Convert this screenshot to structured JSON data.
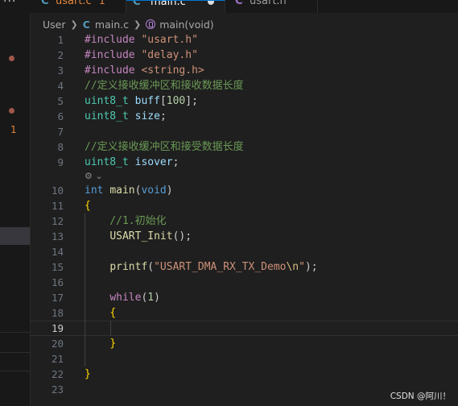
{
  "tabs": [
    {
      "icon": "C",
      "name": "usart.c",
      "badge": "1",
      "active": false,
      "modified": false
    },
    {
      "icon": "C",
      "name": "main.c",
      "active": true,
      "modified": true
    },
    {
      "icon": "C",
      "name": "usart.h",
      "active": false,
      "modified": false
    }
  ],
  "breadcrumb": {
    "root": "User",
    "file_icon": "C",
    "file": "main.c",
    "symbol": "main(void)"
  },
  "sidebar": {
    "badge": "1"
  },
  "editor": {
    "current_line": 19,
    "inlay_hint": "⚙ ⌄",
    "lines": [
      {
        "n": "1",
        "code": "#include \"usart.h\""
      },
      {
        "n": "2",
        "code": "#include \"delay.h\""
      },
      {
        "n": "3",
        "code": "#include <string.h>"
      },
      {
        "n": "4",
        "code": "//定义接收缓冲区和接收数据长度"
      },
      {
        "n": "5",
        "code": "uint8_t buff[100];"
      },
      {
        "n": "6",
        "code": "uint8_t size;"
      },
      {
        "n": "7",
        "code": ""
      },
      {
        "n": "8",
        "code": "//定义接收缓冲区和接受数据长度"
      },
      {
        "n": "9",
        "code": "uint8_t isover;"
      },
      {
        "n": "10",
        "code": "int main(void)"
      },
      {
        "n": "11",
        "code": "{"
      },
      {
        "n": "12",
        "code": "    //1.初始化"
      },
      {
        "n": "13",
        "code": "    USART_Init();"
      },
      {
        "n": "14",
        "code": ""
      },
      {
        "n": "15",
        "code": "    printf(\"USART_DMA_RX_TX_Demo\\n\");"
      },
      {
        "n": "16",
        "code": ""
      },
      {
        "n": "17",
        "code": "    while(1)"
      },
      {
        "n": "18",
        "code": "    {"
      },
      {
        "n": "19",
        "code": ""
      },
      {
        "n": "20",
        "code": "    }"
      },
      {
        "n": "21",
        "code": ""
      },
      {
        "n": "22",
        "code": "}"
      },
      {
        "n": "23",
        "code": ""
      }
    ]
  },
  "watermark": "CSDN @阿川！"
}
